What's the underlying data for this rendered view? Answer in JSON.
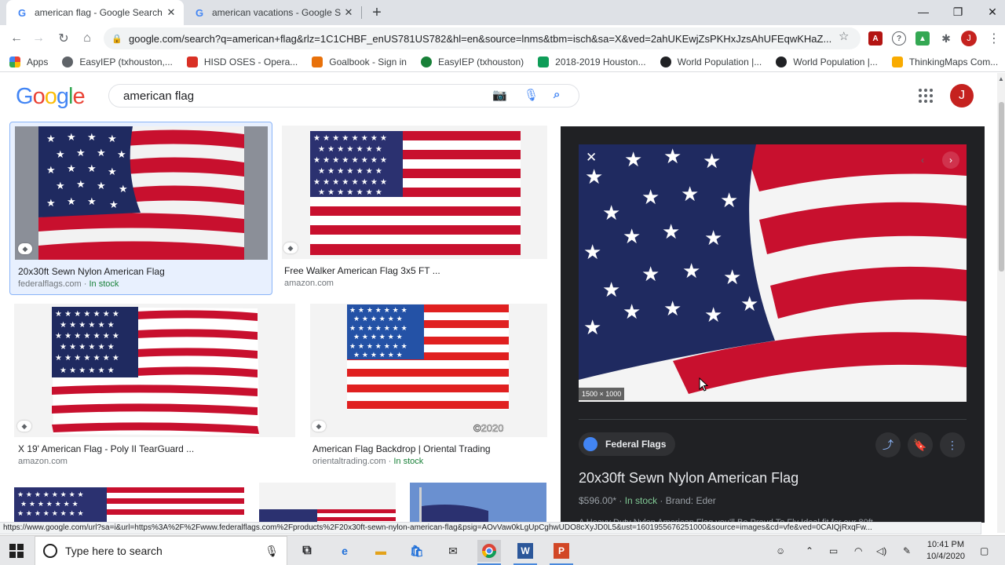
{
  "browser": {
    "tabs": [
      {
        "title": "american flag - Google Search",
        "active": true
      },
      {
        "title": "american vacations - Google Sea",
        "active": false
      }
    ],
    "url": "google.com/search?q=american+flag&rlz=1C1CHBF_enUS781US782&hl=en&source=lnms&tbm=isch&sa=X&ved=2ahUKEwjZsPKHxJzsAhUFEqwKHaZ...",
    "profile_initial": "J"
  },
  "bookmarks": [
    {
      "label": "Apps",
      "color": "#ea4335"
    },
    {
      "label": "EasyIEP (txhouston,...",
      "color": "#5f6368"
    },
    {
      "label": "HISD OSES - Opera...",
      "color": "#d93025"
    },
    {
      "label": "Goalbook - Sign in",
      "color": "#e8710a"
    },
    {
      "label": "EasyIEP (txhouston)",
      "color": "#188038"
    },
    {
      "label": "2018-2019 Houston...",
      "color": "#0f9d58"
    },
    {
      "label": "World Population |...",
      "color": "#202124"
    },
    {
      "label": "World Population |...",
      "color": "#202124"
    },
    {
      "label": "ThinkingMaps Com...",
      "color": "#f9ab00"
    }
  ],
  "google": {
    "logo": "Google",
    "query": "american flag",
    "avatar_initial": "J"
  },
  "results": [
    {
      "title": "20x30ft Sewn Nylon American Flag",
      "source": "federalflags.com",
      "stock": "In stock"
    },
    {
      "title": "Free Walker American Flag 3x5 FT ...",
      "source": "amazon.com",
      "stock": ""
    },
    {
      "title": "X 19' American Flag - Poly II TearGuard ...",
      "source": "amazon.com",
      "stock": ""
    },
    {
      "title": "American Flag Backdrop | Oriental Trading",
      "source": "orientaltrading.com",
      "stock": "In stock"
    }
  ],
  "watermark": "©2020",
  "panel": {
    "dimensions": "1500 × 1000",
    "source_name": "Federal Flags",
    "title": "20x30ft Sewn Nylon American Flag",
    "price": "$596.00*",
    "stock": "In stock",
    "brand": "Brand: Eder",
    "description": "A Heavy Duty Nylon American Flag you'll Be Proud To Fly Ideal fit for our 80ft ..."
  },
  "statusbar": "https://www.google.com/url?sa=i&url=https%3A%2F%2Fwww.federalflags.com%2Fproducts%2F20x30ft-sewn-nylon-american-flag&psig=AOvVaw0kLgUpCghwUDO8cXyJD0L5&ust=1601955676251000&source=images&cd=vfe&ved=0CAIQjRxqFw...",
  "taskbar": {
    "search_placeholder": "Type here to search",
    "time": "10:41 PM",
    "date": "10/4/2020"
  },
  "colors": {
    "flag_red": "#c8102e",
    "flag_blue": "#1f2a60",
    "panel_bg": "#202124"
  }
}
